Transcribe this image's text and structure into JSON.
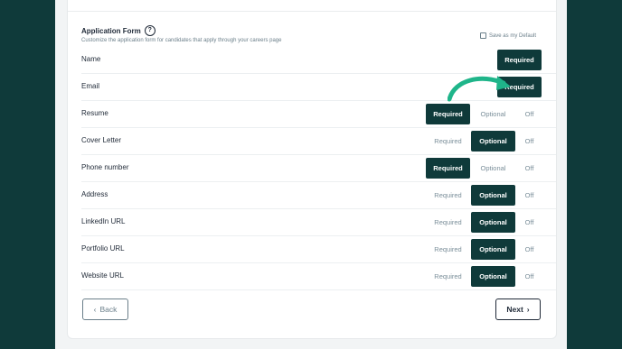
{
  "header": {
    "title": "Application Form",
    "help_icon": "?",
    "subtitle": "Customize the application form for candidates that apply through your careers page",
    "save_default": "Save as my Default"
  },
  "option_labels": {
    "required": "Required",
    "optional": "Optional",
    "off": "Off"
  },
  "fields": [
    {
      "label": "Name",
      "selected": "Required",
      "options": [
        "Required"
      ]
    },
    {
      "label": "Email",
      "selected": "Required",
      "options": [
        "Required"
      ]
    },
    {
      "label": "Resume",
      "selected": "Required",
      "options": [
        "Required",
        "Optional",
        "Off"
      ]
    },
    {
      "label": "Cover Letter",
      "selected": "Optional",
      "options": [
        "Required",
        "Optional",
        "Off"
      ]
    },
    {
      "label": "Phone number",
      "selected": "Required",
      "options": [
        "Required",
        "Optional",
        "Off"
      ]
    },
    {
      "label": "Address",
      "selected": "Optional",
      "options": [
        "Required",
        "Optional",
        "Off"
      ]
    },
    {
      "label": "LinkedIn URL",
      "selected": "Optional",
      "options": [
        "Required",
        "Optional",
        "Off"
      ]
    },
    {
      "label": "Portfolio URL",
      "selected": "Optional",
      "options": [
        "Required",
        "Optional",
        "Off"
      ]
    },
    {
      "label": "Website URL",
      "selected": "Optional",
      "options": [
        "Required",
        "Optional",
        "Off"
      ]
    }
  ],
  "footer": {
    "back_label": "Back",
    "next_label": "Next"
  },
  "colors": {
    "primary": "#0f3a3a",
    "arrow": "#1fb58a",
    "muted": "#7b8f9a"
  }
}
